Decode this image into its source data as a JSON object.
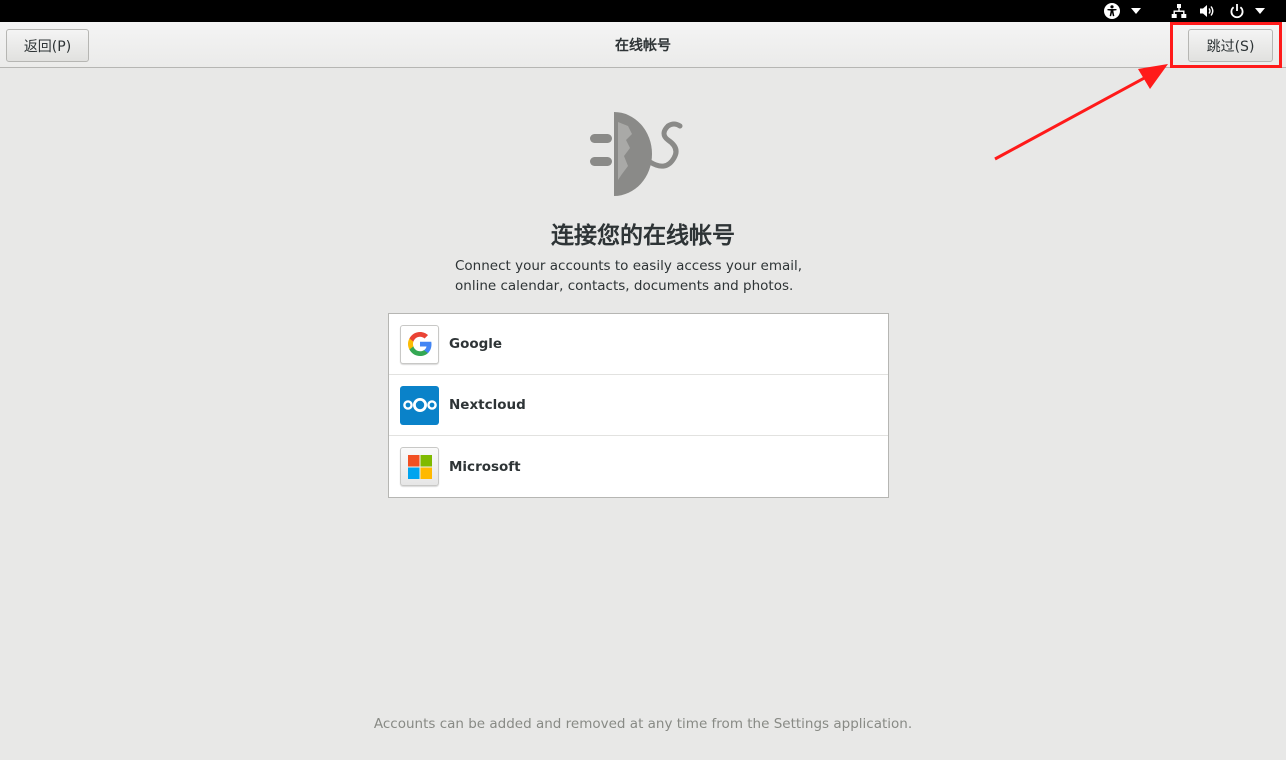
{
  "header": {
    "back_label": "返回(P)",
    "title": "在线帐号",
    "skip_label": "跳过(S)"
  },
  "main": {
    "heading": "连接您的在线帐号",
    "description_line1": "Connect your accounts to easily access your email,",
    "description_line2": "online calendar, contacts, documents and photos.",
    "providers": [
      {
        "name": "Google",
        "icon": "google-icon"
      },
      {
        "name": "Nextcloud",
        "icon": "nextcloud-icon"
      },
      {
        "name": "Microsoft",
        "icon": "microsoft-icon"
      }
    ],
    "footer": "Accounts can be added and removed at any time from the Settings application."
  },
  "system_bar": {
    "icons": [
      "accessibility-icon",
      "network-icon",
      "volume-icon",
      "power-icon"
    ]
  },
  "annotation": {
    "highlight_color": "#ff1a1a"
  },
  "colors": {
    "background": "#e8e8e7",
    "nextcloud_blue": "#0a82c9"
  }
}
